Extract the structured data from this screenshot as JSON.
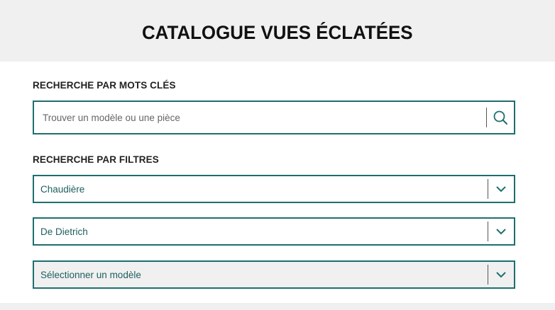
{
  "header": {
    "title": "CATALOGUE VUES ÉCLATÉES"
  },
  "keyword_search": {
    "label": "RECHERCHE PAR MOTS CLÉS",
    "placeholder": "Trouver un modèle ou une pièce",
    "value": ""
  },
  "filters": {
    "label": "RECHERCHE PAR FILTRES",
    "selects": [
      {
        "value": "Chaudière"
      },
      {
        "value": "De Dietrich"
      },
      {
        "value": "Sélectionner un modèle"
      }
    ]
  },
  "colors": {
    "accent": "#1e6e6e",
    "header_bg": "#f0f0f0",
    "disabled_bg": "#f0f0f0"
  },
  "icons": {
    "search": "search-icon",
    "chevron": "chevron-down-icon"
  }
}
